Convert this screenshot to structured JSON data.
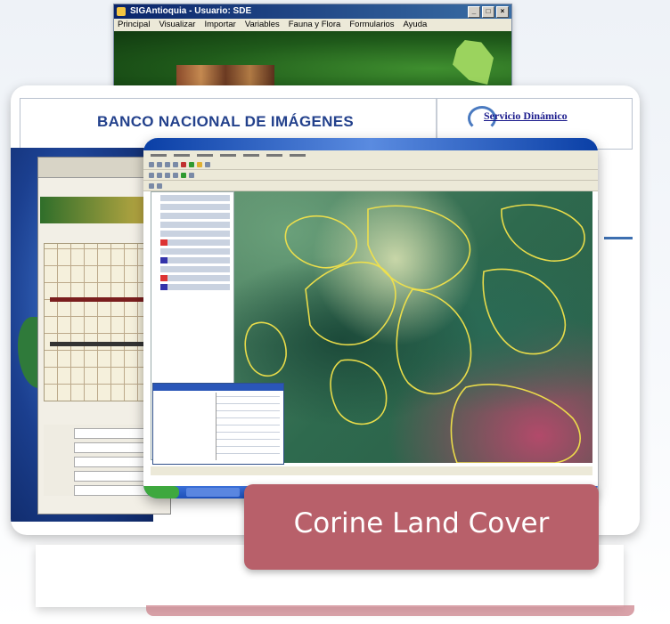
{
  "back_window": {
    "title": "SIGAntioquia - Usuario: SDE",
    "menu": [
      "Principal",
      "Visualizar",
      "Importar",
      "Variables",
      "Fauna y Flora",
      "Formularios",
      "Ayuda"
    ]
  },
  "middle_window": {
    "title": "BANCO NACIONAL DE IMÁGENES",
    "link": "Servicio Dinámico"
  },
  "caption": "Corine Land Cover",
  "colors": {
    "caption_bg": "#b8606a",
    "banco_title": "#23418c",
    "titlebar": "#0a246a"
  }
}
